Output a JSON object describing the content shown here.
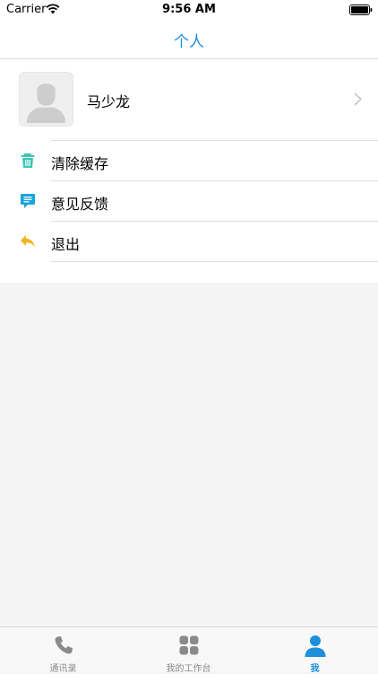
{
  "status_bar": {
    "carrier": "Carrier",
    "time": "9:56 AM"
  },
  "nav": {
    "title": "个人"
  },
  "profile": {
    "name": "马少龙"
  },
  "menu": {
    "items": [
      {
        "label": "清除缓存",
        "icon": "trash-icon",
        "color": "#3cc6b5"
      },
      {
        "label": "意见反馈",
        "icon": "feedback-icon",
        "color": "#1aa3db"
      },
      {
        "label": "退出",
        "icon": "reply-icon",
        "color": "#f3b31b"
      }
    ]
  },
  "tab_bar": {
    "tabs": [
      {
        "label": "通讯录",
        "icon": "phone-icon",
        "active": false
      },
      {
        "label": "我的工作台",
        "icon": "grid-icon",
        "active": false
      },
      {
        "label": "我",
        "icon": "person-icon",
        "active": true
      }
    ]
  },
  "colors": {
    "accent": "#1d8fdb",
    "inactive": "#8a8a8a",
    "background": "#f4f4f4"
  }
}
